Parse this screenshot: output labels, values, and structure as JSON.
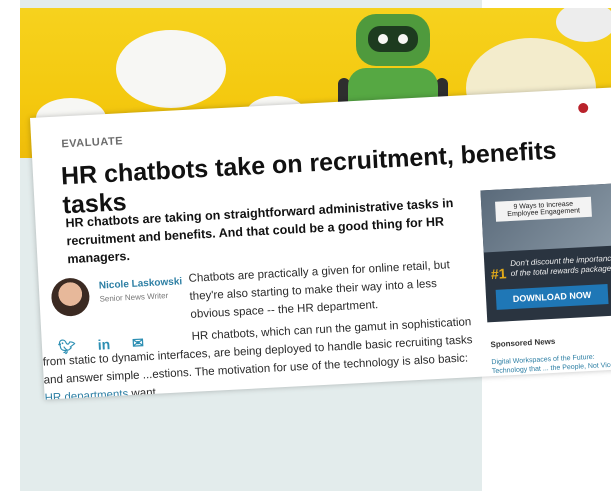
{
  "article": {
    "eyebrow": "EVALUATE",
    "headline": "HR chatbots take on recruitment, benefits tasks",
    "dek": "HR chatbots are taking on straightforward administrative tasks in recruitment and benefits. And that could be a good thing for HR managers.",
    "author": {
      "name": "Nicole Laskowski",
      "role": "Senior News Writer"
    },
    "social": [
      "twitter-icon",
      "linkedin-icon",
      "email-icon"
    ],
    "paragraph1": "Chatbots are practically a given for online retail, but they're also starting to make their way into a less obvious space -- the HR department.",
    "paragraph2_start": "HR chatbots, which can run the gamut in sophistication from static to dynamic interfaces, are being deployed to handle basic recruiting tasks and answer simple",
    "paragraph2_mid": "...estions. The motivation for use of the technology is also basic:",
    "paragraph2_link": "HR departments",
    "paragraph2_end": "want"
  },
  "ad": {
    "tag": "9 Ways to Increase Employee Engagement",
    "rank": "#1",
    "copy": "Don't discount the importance of the total rewards package",
    "button": "DOWNLOAD NOW"
  },
  "sidebar": {
    "sponsored_title": "Sponsored News",
    "sponsored_link": "Digital Workspaces of the Future: Technology that ... the People, Not Vice ..."
  },
  "colors": {
    "hero_yellow": "#f4c90f",
    "link_blue": "#2d7fa4",
    "button_blue": "#1f77b6",
    "robot_green": "#56a843"
  }
}
